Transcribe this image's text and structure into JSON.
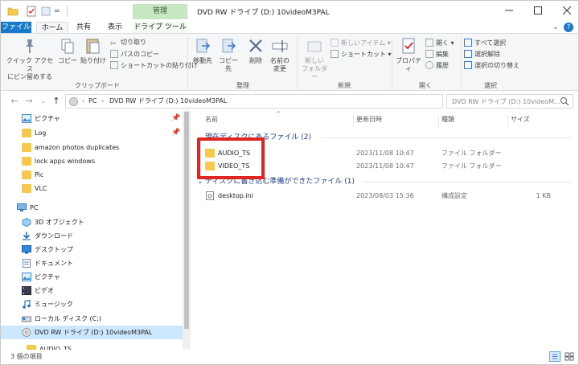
{
  "window": {
    "title": "DVD RW ドライブ (D:) 10videoM3PAL",
    "context_tab_group": "管理"
  },
  "quick_access_toolbar": {
    "dropdown_glyph": "="
  },
  "tabs": [
    {
      "label": "ファイル"
    },
    {
      "label": "ホーム"
    },
    {
      "label": "共有"
    },
    {
      "label": "表示"
    },
    {
      "label": "ドライブ ツール"
    }
  ],
  "ribbon": {
    "clipboard": {
      "pin_quick_access": "クイック アクセス\nにピン留めする",
      "copy": "コピー",
      "paste": "貼り付け",
      "cut": "切り取り",
      "copy_path": "パスのコピー",
      "paste_shortcut": "ショートカットの貼り付け",
      "group_label": "クリップボード"
    },
    "organize": {
      "move_to": "移動先",
      "copy_to": "コピー先",
      "delete": "削除",
      "rename": "名前の\n変更",
      "group_label": "整理"
    },
    "new": {
      "new_folder": "新しい\nフォルダー",
      "new_item": "新しいアイテム",
      "shortcut": "ショートカット",
      "group_label": "新規"
    },
    "open": {
      "properties": "プロパティ",
      "open": "開く",
      "edit": "編集",
      "history": "履歴",
      "group_label": "開く"
    },
    "select": {
      "select_all": "すべて選択",
      "select_none": "選択解除",
      "invert_selection": "選択の切り替え",
      "group_label": "選択"
    }
  },
  "address": {
    "segments": [
      "PC",
      "DVD RW ドライブ (D:) 10videoM3PAL"
    ],
    "search_placeholder": "DVD RW ドライブ (D:) 10videoM..."
  },
  "nav_pane": {
    "pinned": [
      {
        "label": "ピクチャ",
        "pinned": true,
        "icon": "pictures-icon"
      },
      {
        "label": "Log",
        "pinned": true,
        "icon": "folder-icon"
      },
      {
        "label": "amazon photos duplicates",
        "pinned": false,
        "icon": "folder-icon"
      },
      {
        "label": "lock apps windows",
        "pinned": false,
        "icon": "folder-icon"
      },
      {
        "label": "Pic",
        "pinned": false,
        "icon": "folder-icon"
      },
      {
        "label": "VLC",
        "pinned": false,
        "icon": "folder-icon"
      }
    ],
    "pc_label": "PC",
    "pc_children": [
      {
        "label": "3D オブジェクト",
        "icon": "3d-objects-icon"
      },
      {
        "label": "ダウンロード",
        "icon": "download-icon"
      },
      {
        "label": "デスクトップ",
        "icon": "desktop-icon"
      },
      {
        "label": "ドキュメント",
        "icon": "documents-icon"
      },
      {
        "label": "ピクチャ",
        "icon": "pictures-icon"
      },
      {
        "label": "ビデオ",
        "icon": "videos-icon"
      },
      {
        "label": "ミュージック",
        "icon": "music-icon"
      },
      {
        "label": "ローカル ディスク (C:)",
        "icon": "local-disk-icon"
      },
      {
        "label": "DVD RW ドライブ (D:) 10videoM3PAL",
        "icon": "dvd-drive-icon",
        "selected": true
      },
      {
        "label": "AUDIO_TS",
        "icon": "folder-icon"
      }
    ]
  },
  "columns": {
    "name": "名前",
    "modified": "更新日時",
    "type": "種類",
    "size": "サイズ"
  },
  "groups": [
    {
      "header": "現在ディスクにあるファイル (2)",
      "rows": [
        {
          "name": "AUDIO_TS",
          "modified": "2023/11/08 10:47",
          "type": "ファイル フォルダー",
          "size": ""
        },
        {
          "name": "VIDEO_TS",
          "modified": "2023/11/08 10:47",
          "type": "ファイル フォルダー",
          "size": ""
        }
      ]
    },
    {
      "header": "ディスクに書き込む準備ができたファイル (1)",
      "rows": [
        {
          "name": "desktop.ini",
          "modified": "2023/08/03 15:36",
          "type": "構成設定",
          "size": "1 KB"
        }
      ]
    }
  ],
  "status": {
    "item_count": "3 個の項目"
  },
  "colors": {
    "accent": "#1979ca",
    "manage_band": "#c6e7c1",
    "selection": "#cce8ff",
    "highlight_box": "#e0241f",
    "folder": "#f6c84c",
    "group_header": "#1e3d8a"
  }
}
